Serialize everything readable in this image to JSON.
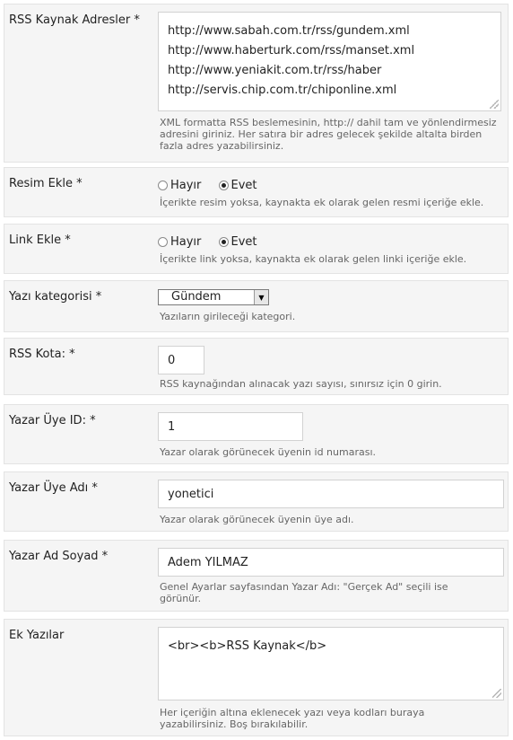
{
  "rss_addresses": {
    "label": "RSS Kaynak Adresler *",
    "lines": [
      "http://www.sabah.com.tr/rss/gundem.xml",
      "http://www.haberturk.com/rss/manset.xml",
      "http://www.yeniakit.com.tr/rss/haber",
      "http://servis.chip.com.tr/chiponline.xml"
    ],
    "description": "XML formatta RSS beslemesinin, http:// dahil tam ve yönlendirmesiz adresini giriniz. Her satıra bir adres gelecek şekilde altalta birden fazla adres yazabilirsiniz."
  },
  "image_add": {
    "label": "Resim Ekle *",
    "options": [
      "Hayır",
      "Evet"
    ],
    "selected": "Evet",
    "description": "İçerikte resim yoksa, kaynakta ek olarak gelen resmi içeriğe ekle."
  },
  "link_add": {
    "label": "Link Ekle *",
    "options": [
      "Hayır",
      "Evet"
    ],
    "selected": "Evet",
    "description": "İçerikte link yoksa, kaynakta ek olarak gelen linki içeriğe ekle."
  },
  "category": {
    "label": "Yazı kategorisi *",
    "value": "Gündem",
    "description": "Yazıların girileceği kategori."
  },
  "quota": {
    "label": "RSS Kota: *",
    "value": "0",
    "description": "RSS kaynağından alınacak yazı sayısı, sınırsız için 0 girin."
  },
  "author_id": {
    "label": "Yazar Üye ID: *",
    "value": "1",
    "description": "Yazar olarak görünecek üyenin id numarası."
  },
  "author_username": {
    "label": "Yazar Üye Adı *",
    "value": "yonetici",
    "description": "Yazar olarak görünecek üyenin üye adı."
  },
  "author_fullname": {
    "label": "Yazar Ad Soyad *",
    "value": "Adem YILMAZ",
    "description": "Genel Ayarlar sayfasından Yazar Adı: \"Gerçek Ad\" seçili ise görünür."
  },
  "extra_text": {
    "label": "Ek Yazılar",
    "value": "<br><b>RSS Kaynak</b>",
    "description": "Her içeriğin altına eklenecek yazı veya kodları buraya yazabilirsiniz. Boş bırakılabilir."
  }
}
